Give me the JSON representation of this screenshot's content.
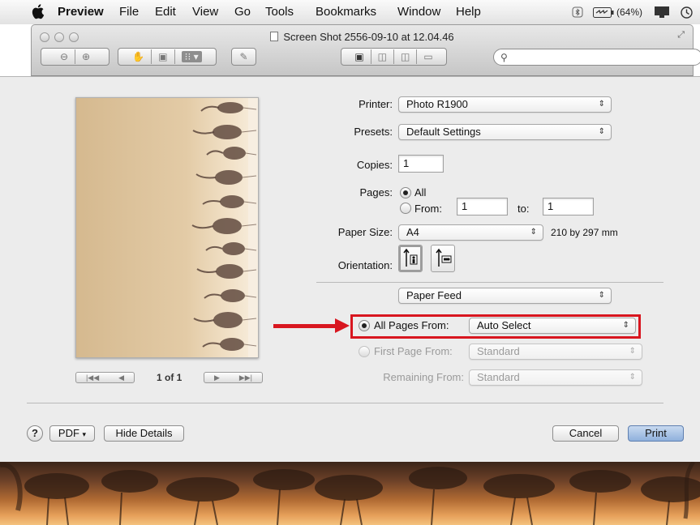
{
  "menubar": {
    "app_name": "Preview",
    "items": [
      "File",
      "Edit",
      "View",
      "Go",
      "Tools",
      "Bookmarks",
      "Window",
      "Help"
    ],
    "battery_text": "(64%)"
  },
  "window": {
    "title": "Screen Shot 2556-09-10 at 12.04.46"
  },
  "print": {
    "printer_label": "Printer:",
    "printer_value": "Photo R1900",
    "presets_label": "Presets:",
    "presets_value": "Default Settings",
    "copies_label": "Copies:",
    "copies_value": "1",
    "pages_label": "Pages:",
    "pages_all": "All",
    "pages_from": "From:",
    "pages_from_value": "1",
    "pages_to": "to:",
    "pages_to_value": "1",
    "paper_size_label": "Paper Size:",
    "paper_size_value": "A4",
    "paper_size_dims": "210 by 297 mm",
    "orientation_label": "Orientation:",
    "section_value": "Paper Feed",
    "all_pages_from_label": "All Pages From:",
    "all_pages_from_value": "Auto Select",
    "first_page_from_label": "First Page From:",
    "first_page_from_value": "Standard",
    "remaining_from_label": "Remaining From:",
    "remaining_from_value": "Standard",
    "page_count": "1 of 1",
    "help_label": "?",
    "pdf_label": "PDF",
    "hide_details_label": "Hide Details",
    "cancel_label": "Cancel",
    "print_label": "Print"
  },
  "icons": [
    "apple-icon",
    "bluetooth-icon",
    "battery-icon",
    "display-icon",
    "time-machine-icon",
    "search-icon",
    "zoom-out-icon",
    "zoom-in-icon",
    "hand-icon",
    "text-select-icon",
    "annotate-icon",
    "pencil-icon",
    "view-mode-icon",
    "portrait-icon",
    "landscape-icon"
  ],
  "colors": {
    "highlight": "#d8161f",
    "default_button": "#8fb0dc"
  }
}
